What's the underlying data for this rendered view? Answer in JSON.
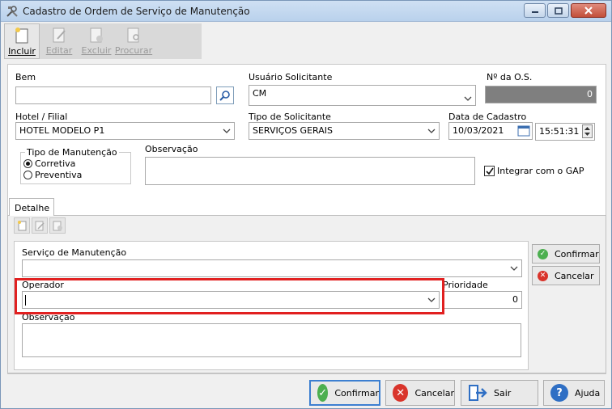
{
  "window": {
    "title": "Cadastro de Ordem de Serviço de Manutenção"
  },
  "toolbar": {
    "incluir": "Incluir",
    "editar": "Editar",
    "excluir": "Excluir",
    "procurar": "Procurar"
  },
  "form": {
    "bem_label": "Bem",
    "bem_value": "",
    "usuario_label": "Usuário Solicitante",
    "usuario_value": "CM",
    "nos_label": "Nº da O.S.",
    "nos_value": "0",
    "hotel_label": "Hotel / Filial",
    "hotel_value": "HOTEL MODELO P1",
    "tipo_sol_label": "Tipo de Solicitante",
    "tipo_sol_value": "SERVIÇOS GERAIS",
    "data_label": "Data de Cadastro",
    "data_value": "10/03/2021",
    "hora_value": "15:51:31",
    "tipo_manut_label": "Tipo de Manutenção",
    "corretiva": "Corretiva",
    "preventiva": "Preventiva",
    "obs_label": "Observação",
    "obs_value": "",
    "gap_label": "Integrar com o GAP"
  },
  "detail": {
    "tab_label": "Detalhe",
    "servico_label": "Serviço de Manutenção",
    "servico_value": "",
    "operador_label": "Operador",
    "operador_value": "",
    "prioridade_label": "Prioridade",
    "prioridade_value": "0",
    "obs_label": "Observação",
    "obs_value": "",
    "confirmar": "Confirmar",
    "cancelar": "Cancelar"
  },
  "footer": {
    "confirmar": "Confirmar",
    "cancelar": "Cancelar",
    "sair": "Sair",
    "ajuda": "Ajuda"
  },
  "colors": {
    "accent": "#3c7fd1",
    "highlight": "#e12020",
    "confirm_green": "#4caf50",
    "cancel_red": "#d9342b",
    "help_blue": "#2f6fc4"
  }
}
